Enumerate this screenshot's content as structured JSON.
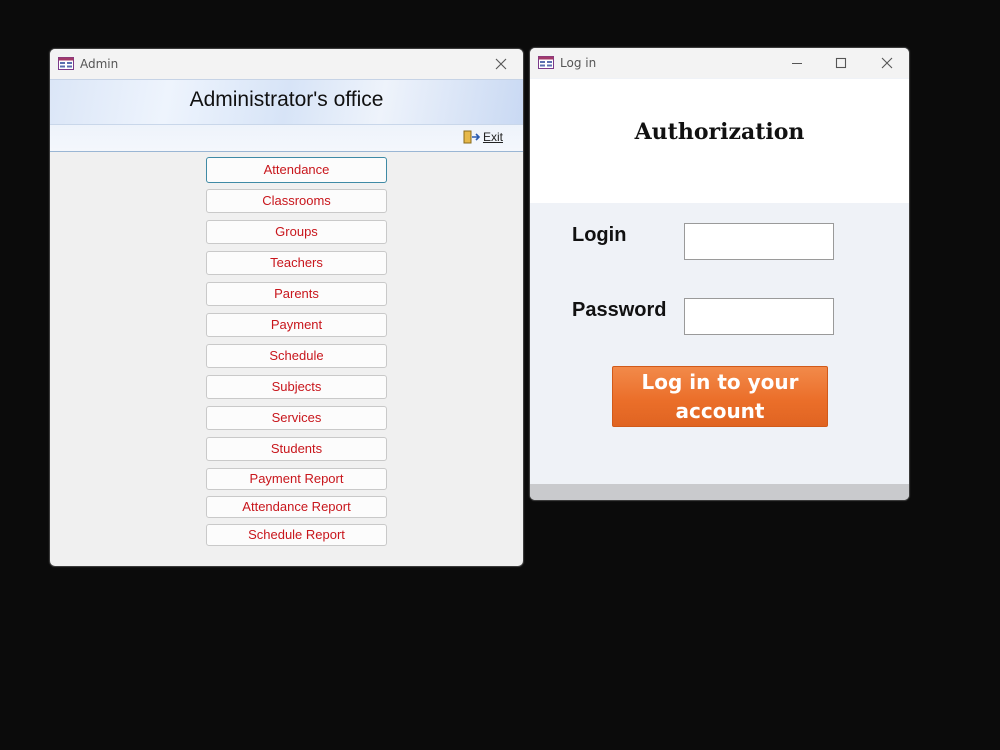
{
  "admin": {
    "window_title": "Admin",
    "header_title": "Administrator's office",
    "exit_label": "Exit",
    "menu": [
      "Attendance",
      "Classrooms",
      "Groups",
      "Teachers",
      "Parents",
      "Payment",
      "Schedule",
      "Subjects",
      "Services",
      "Students",
      "Payment Report",
      "Attendance Report",
      "Schedule Report"
    ]
  },
  "login": {
    "window_title": "Log in",
    "heading": "Authorization",
    "login_label": "Login",
    "password_label": "Password",
    "login_value": "",
    "password_value": "",
    "submit_line1": "Log in to your",
    "submit_line2": "account"
  },
  "colors": {
    "menu_text": "#c8161c",
    "submit_button": "#eb6f2a",
    "desktop": "#0b0b0b"
  }
}
